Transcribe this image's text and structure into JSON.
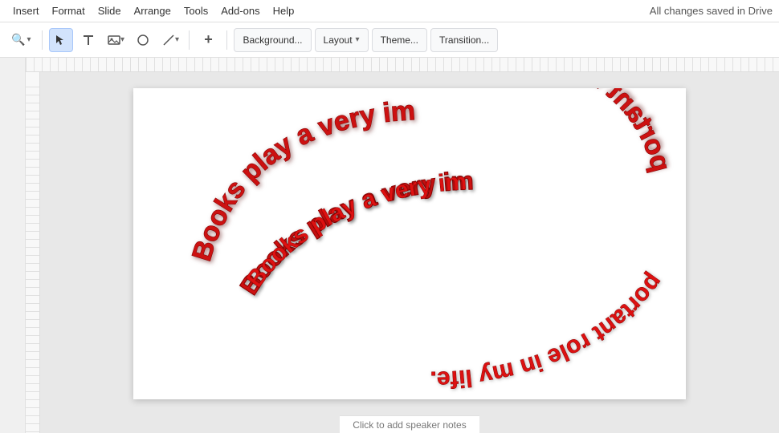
{
  "menubar": {
    "items": [
      "Insert",
      "Format",
      "Slide",
      "Arrange",
      "Tools",
      "Add-ons",
      "Help"
    ],
    "save_status": "All changes saved in Drive"
  },
  "toolbar": {
    "zoom_label": "Q",
    "background_btn": "Background...",
    "layout_btn": "Layout",
    "theme_btn": "Theme...",
    "transition_btn": "Transition...",
    "plus_icon": "+",
    "cursor_icon": "↖",
    "text_icon": "T",
    "image_icon": "🖼",
    "shape_icon": "○",
    "line_icon": "╲"
  },
  "slide": {
    "text": "Books play a very important role in my life.",
    "text_color": "#cc1111"
  },
  "speaker_notes": {
    "placeholder": "Click to add speaker notes"
  },
  "icons": {
    "chevron_down": "▾",
    "dropdown": "▾"
  }
}
